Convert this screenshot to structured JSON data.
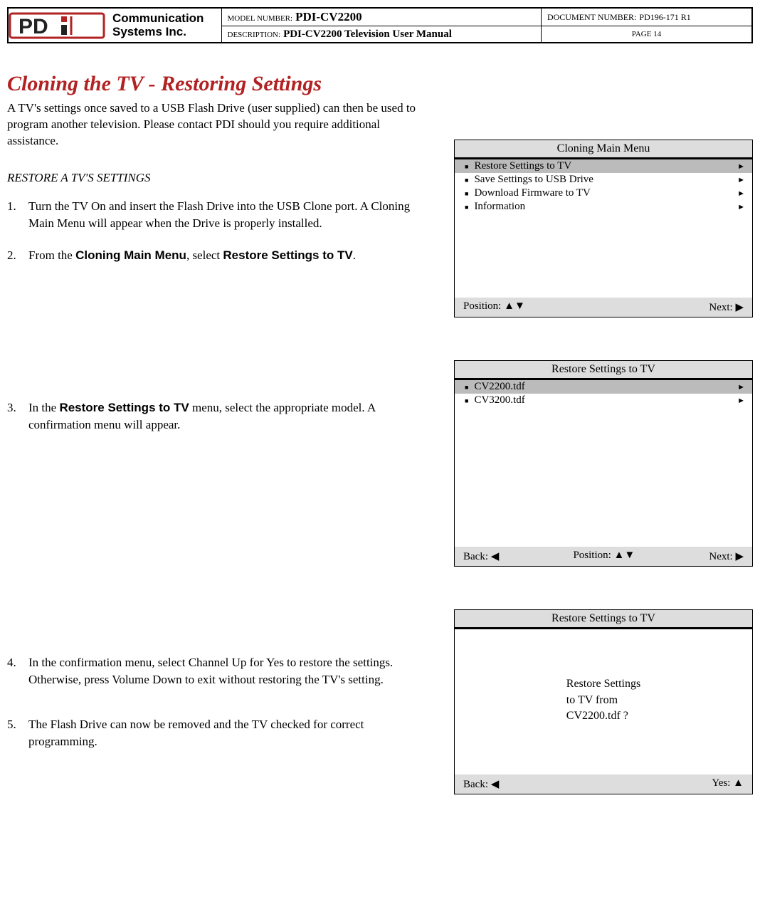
{
  "header": {
    "company_line1": "Communication",
    "company_line2": "Systems Inc.",
    "model_label": "MODEL NUMBER:",
    "model_value": "PDI-CV2200",
    "doc_label": "DOCUMENT NUMBER:",
    "doc_value": "PD196-171 R1",
    "desc_label": "DESCRIPTION:",
    "desc_value": "PDI-CV2200 Television User Manual",
    "page_label": "PAGE 14"
  },
  "title": "Cloning the TV - Restoring Settings",
  "intro": "A TV's settings once saved to a USB Flash Drive (user supplied) can then be used to program another television.  Please contact PDI should you require additional assistance.",
  "subheading": "RESTORE A TV'S SETTINGS",
  "steps": {
    "s1": "Turn the TV On and insert the Flash Drive into the USB Clone port.  A Cloning Main Menu will appear when the Drive is properly installed.",
    "s2a": "From the ",
    "s2b": "Cloning Main Menu",
    "s2c": ", select ",
    "s2d": "Restore Settings to TV",
    "s2e": ".",
    "s3a": "In the ",
    "s3b": "Restore Settings to TV",
    "s3c": " menu, select the appropriate model.  A confirmation menu will appear.",
    "s4": "In the confirmation menu, select Channel Up for Yes to restore the settings.  Otherwise, press Volume Down to exit without restoring the TV's setting.",
    "s5": "The Flash Drive can now be removed and the TV checked for correct programming."
  },
  "menu1": {
    "title": "Cloning Main Menu",
    "items": [
      "Restore Settings to TV",
      "Save Settings to USB Drive",
      "Download Firmware to TV",
      "Information"
    ],
    "footer_left": "Position: ▲▼",
    "footer_right": "Next: ▶"
  },
  "menu2": {
    "title": "Restore Settings to TV",
    "items": [
      "CV2200.tdf",
      "CV3200.tdf"
    ],
    "footer_left": "Back: ◀",
    "footer_mid": "Position: ▲▼",
    "footer_right": "Next: ▶"
  },
  "menu3": {
    "title": "Restore Settings to TV",
    "line1": "Restore Settings",
    "line2": "to TV from",
    "line3": "CV2200.tdf ?",
    "footer_left": "Back: ◀",
    "footer_right": "Yes: ▲"
  }
}
